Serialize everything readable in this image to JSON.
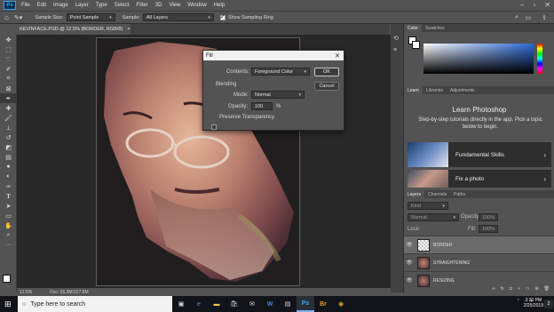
{
  "menubar": {
    "logo": "Ps",
    "items": [
      "File",
      "Edit",
      "Image",
      "Layer",
      "Type",
      "Select",
      "Filter",
      "3D",
      "View",
      "Window",
      "Help"
    ]
  },
  "optbar": {
    "sample_size_label": "Sample Size:",
    "sample_size_value": "Point Sample",
    "sample_label": "Sample:",
    "sample_value": "All Layers",
    "show_ring_label": "Show Sampling Ring",
    "show_ring_checked": true
  },
  "document": {
    "tab_title": "KEVINFACE.PSD @ 12.5% (BORDER, RGB/8)",
    "tab_close": "×",
    "status_zoom": "12.5%",
    "status_doc": "Doc: 55.3M/227.6M"
  },
  "fill_dialog": {
    "title": "Fill",
    "contents_label": "Contents:",
    "contents_value": "Foreground Color",
    "blending_label": "Blending",
    "mode_label": "Mode:",
    "mode_value": "Normal",
    "opacity_label": "Opacity:",
    "opacity_value": "100",
    "opacity_unit": "%",
    "preserve_label": "Preserve Transparency",
    "ok_label": "OK",
    "cancel_label": "Cancel"
  },
  "color_panel": {
    "tabs": [
      "Color",
      "Swatches"
    ]
  },
  "learn_panel": {
    "tabs": [
      "Learn",
      "Libraries",
      "Adjustments"
    ],
    "heading": "Learn Photoshop",
    "description": "Step-by-step tutorials directly in the app. Pick a topic below to begin.",
    "topics": [
      "Fundamental Skills",
      "Fix a photo"
    ]
  },
  "layers_panel": {
    "tabs": [
      "Layers",
      "Channels",
      "Paths"
    ],
    "filter_placeholder": "Kind",
    "blend_mode": "Normal",
    "opacity_label": "Opacity:",
    "opacity_value": "100%",
    "lock_label": "Lock:",
    "fill_label": "Fill:",
    "fill_value": "100%",
    "layers": [
      {
        "name": "BORDER",
        "selected": true
      },
      {
        "name": "STRAIGHTENING",
        "selected": false
      },
      {
        "name": "RESIZING",
        "selected": false
      }
    ]
  },
  "taskbar": {
    "search_placeholder": "Type here to search",
    "time": "3:30 PM",
    "date": "2/25/2019",
    "notification_count": "2"
  },
  "colors": {
    "ui_bg": "#535353",
    "panel_dark": "#424242",
    "canvas_bg": "#282828",
    "accent": "#31a8ff"
  }
}
